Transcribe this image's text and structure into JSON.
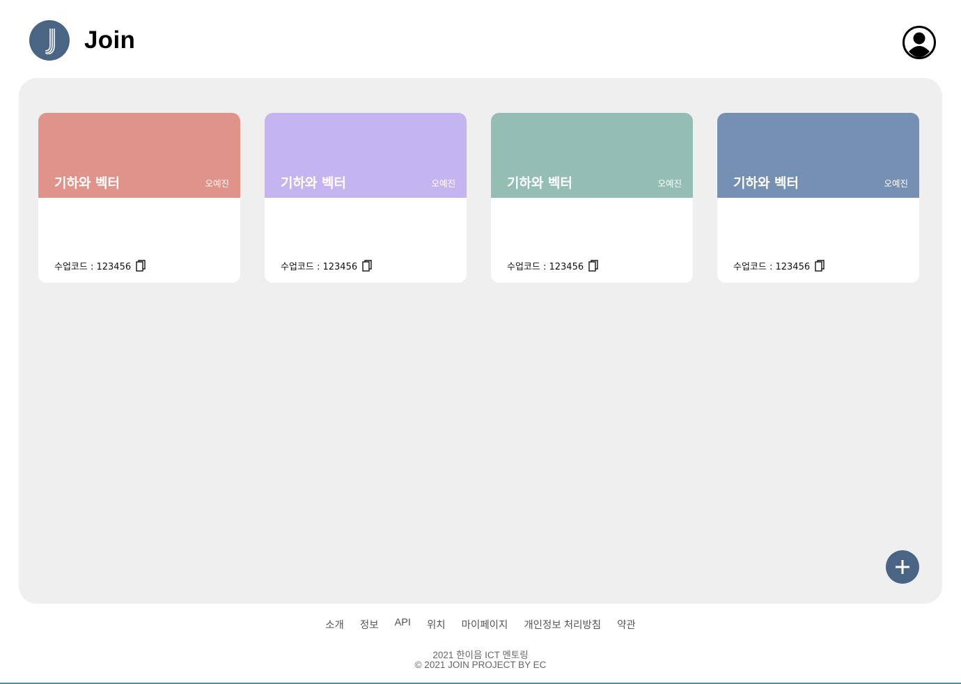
{
  "header": {
    "logo_letter": "J",
    "title": "Join",
    "profile_icon": "user-circle-icon"
  },
  "colors": {
    "brand": "#4a6584",
    "panel_bg": "#efefef"
  },
  "classes": [
    {
      "title": "기하와 벡터",
      "teacher": "오예진",
      "code_label": "수업코드 : 123456",
      "color": "#e09389",
      "copy_icon": "copy-icon"
    },
    {
      "title": "기하와 벡터",
      "teacher": "오예진",
      "code_label": "수업코드 : 123456",
      "color": "#c4b5f1",
      "copy_icon": "copy-icon"
    },
    {
      "title": "기하와 벡터",
      "teacher": "오예진",
      "code_label": "수업코드 : 123456",
      "color": "#94bdb4",
      "copy_icon": "copy-icon"
    },
    {
      "title": "기하와 벡터",
      "teacher": "오예진",
      "code_label": "수업코드 : 123456",
      "color": "#7590b2",
      "copy_icon": "copy-icon"
    }
  ],
  "add_button_icon": "plus-icon",
  "footer": {
    "links": [
      "소개",
      "정보",
      "API",
      "위치",
      "마이페이지",
      "개인정보 처리방침",
      "약관"
    ],
    "line1": "2021 한이음 ICT 멘토링",
    "line2": "© 2021 JOIN PROJECT BY EC"
  }
}
